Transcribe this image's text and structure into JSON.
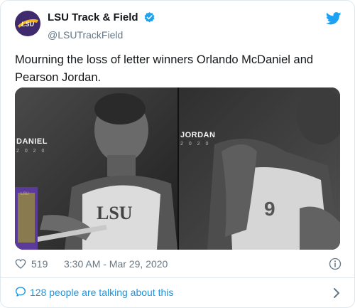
{
  "tweet": {
    "display_name": "LSU Track & Field",
    "handle": "@LSUTrackField",
    "avatar_text": "LSU",
    "text": "Mourning the loss of letter winners Orlando McDaniel and Pearson Jordan.",
    "likes": "519",
    "timestamp": "3:30 AM - Mar 29, 2020",
    "conversation": "128 people are talking about this"
  },
  "media": {
    "left_photo": {
      "name": "DANIEL",
      "year": "2 0 2 0",
      "card_text": "LSU"
    },
    "right_photo": {
      "name": "JORDAN",
      "year": "2 0 2 0"
    }
  },
  "colors": {
    "link": "#1b95e0",
    "muted": "#657786",
    "text": "#14171a",
    "verified": "#1da1f2",
    "lsu_purple": "#3f2a6e",
    "lsu_gold": "#f5b21a"
  },
  "icons": [
    "verified-badge-icon",
    "twitter-bird-icon",
    "heart-icon",
    "info-icon",
    "chat-bubble-icon",
    "chevron-right-icon"
  ]
}
